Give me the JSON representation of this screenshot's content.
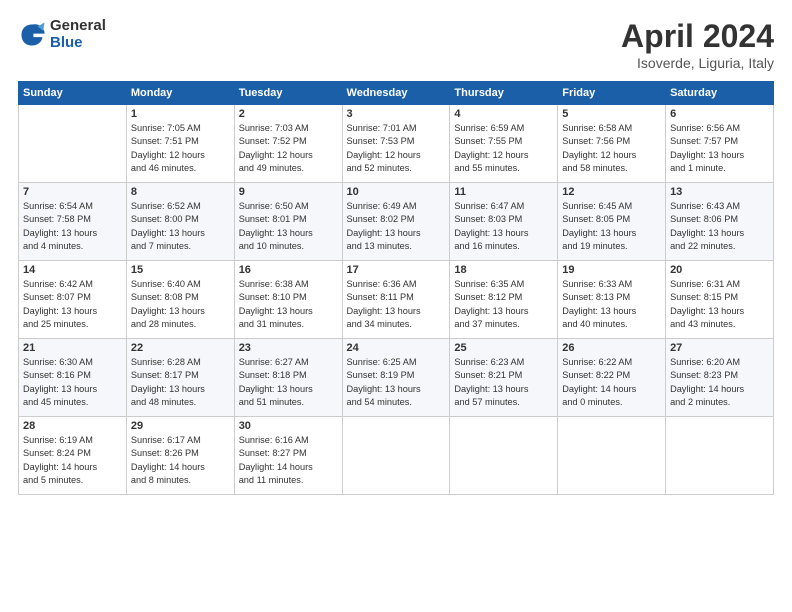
{
  "header": {
    "logo_general": "General",
    "logo_blue": "Blue",
    "title": "April 2024",
    "location": "Isoverde, Liguria, Italy"
  },
  "weekdays": [
    "Sunday",
    "Monday",
    "Tuesday",
    "Wednesday",
    "Thursday",
    "Friday",
    "Saturday"
  ],
  "weeks": [
    [
      {
        "day": "",
        "info": ""
      },
      {
        "day": "1",
        "info": "Sunrise: 7:05 AM\nSunset: 7:51 PM\nDaylight: 12 hours\nand 46 minutes."
      },
      {
        "day": "2",
        "info": "Sunrise: 7:03 AM\nSunset: 7:52 PM\nDaylight: 12 hours\nand 49 minutes."
      },
      {
        "day": "3",
        "info": "Sunrise: 7:01 AM\nSunset: 7:53 PM\nDaylight: 12 hours\nand 52 minutes."
      },
      {
        "day": "4",
        "info": "Sunrise: 6:59 AM\nSunset: 7:55 PM\nDaylight: 12 hours\nand 55 minutes."
      },
      {
        "day": "5",
        "info": "Sunrise: 6:58 AM\nSunset: 7:56 PM\nDaylight: 12 hours\nand 58 minutes."
      },
      {
        "day": "6",
        "info": "Sunrise: 6:56 AM\nSunset: 7:57 PM\nDaylight: 13 hours\nand 1 minute."
      }
    ],
    [
      {
        "day": "7",
        "info": "Sunrise: 6:54 AM\nSunset: 7:58 PM\nDaylight: 13 hours\nand 4 minutes."
      },
      {
        "day": "8",
        "info": "Sunrise: 6:52 AM\nSunset: 8:00 PM\nDaylight: 13 hours\nand 7 minutes."
      },
      {
        "day": "9",
        "info": "Sunrise: 6:50 AM\nSunset: 8:01 PM\nDaylight: 13 hours\nand 10 minutes."
      },
      {
        "day": "10",
        "info": "Sunrise: 6:49 AM\nSunset: 8:02 PM\nDaylight: 13 hours\nand 13 minutes."
      },
      {
        "day": "11",
        "info": "Sunrise: 6:47 AM\nSunset: 8:03 PM\nDaylight: 13 hours\nand 16 minutes."
      },
      {
        "day": "12",
        "info": "Sunrise: 6:45 AM\nSunset: 8:05 PM\nDaylight: 13 hours\nand 19 minutes."
      },
      {
        "day": "13",
        "info": "Sunrise: 6:43 AM\nSunset: 8:06 PM\nDaylight: 13 hours\nand 22 minutes."
      }
    ],
    [
      {
        "day": "14",
        "info": "Sunrise: 6:42 AM\nSunset: 8:07 PM\nDaylight: 13 hours\nand 25 minutes."
      },
      {
        "day": "15",
        "info": "Sunrise: 6:40 AM\nSunset: 8:08 PM\nDaylight: 13 hours\nand 28 minutes."
      },
      {
        "day": "16",
        "info": "Sunrise: 6:38 AM\nSunset: 8:10 PM\nDaylight: 13 hours\nand 31 minutes."
      },
      {
        "day": "17",
        "info": "Sunrise: 6:36 AM\nSunset: 8:11 PM\nDaylight: 13 hours\nand 34 minutes."
      },
      {
        "day": "18",
        "info": "Sunrise: 6:35 AM\nSunset: 8:12 PM\nDaylight: 13 hours\nand 37 minutes."
      },
      {
        "day": "19",
        "info": "Sunrise: 6:33 AM\nSunset: 8:13 PM\nDaylight: 13 hours\nand 40 minutes."
      },
      {
        "day": "20",
        "info": "Sunrise: 6:31 AM\nSunset: 8:15 PM\nDaylight: 13 hours\nand 43 minutes."
      }
    ],
    [
      {
        "day": "21",
        "info": "Sunrise: 6:30 AM\nSunset: 8:16 PM\nDaylight: 13 hours\nand 45 minutes."
      },
      {
        "day": "22",
        "info": "Sunrise: 6:28 AM\nSunset: 8:17 PM\nDaylight: 13 hours\nand 48 minutes."
      },
      {
        "day": "23",
        "info": "Sunrise: 6:27 AM\nSunset: 8:18 PM\nDaylight: 13 hours\nand 51 minutes."
      },
      {
        "day": "24",
        "info": "Sunrise: 6:25 AM\nSunset: 8:19 PM\nDaylight: 13 hours\nand 54 minutes."
      },
      {
        "day": "25",
        "info": "Sunrise: 6:23 AM\nSunset: 8:21 PM\nDaylight: 13 hours\nand 57 minutes."
      },
      {
        "day": "26",
        "info": "Sunrise: 6:22 AM\nSunset: 8:22 PM\nDaylight: 14 hours\nand 0 minutes."
      },
      {
        "day": "27",
        "info": "Sunrise: 6:20 AM\nSunset: 8:23 PM\nDaylight: 14 hours\nand 2 minutes."
      }
    ],
    [
      {
        "day": "28",
        "info": "Sunrise: 6:19 AM\nSunset: 8:24 PM\nDaylight: 14 hours\nand 5 minutes."
      },
      {
        "day": "29",
        "info": "Sunrise: 6:17 AM\nSunset: 8:26 PM\nDaylight: 14 hours\nand 8 minutes."
      },
      {
        "day": "30",
        "info": "Sunrise: 6:16 AM\nSunset: 8:27 PM\nDaylight: 14 hours\nand 11 minutes."
      },
      {
        "day": "",
        "info": ""
      },
      {
        "day": "",
        "info": ""
      },
      {
        "day": "",
        "info": ""
      },
      {
        "day": "",
        "info": ""
      }
    ]
  ]
}
